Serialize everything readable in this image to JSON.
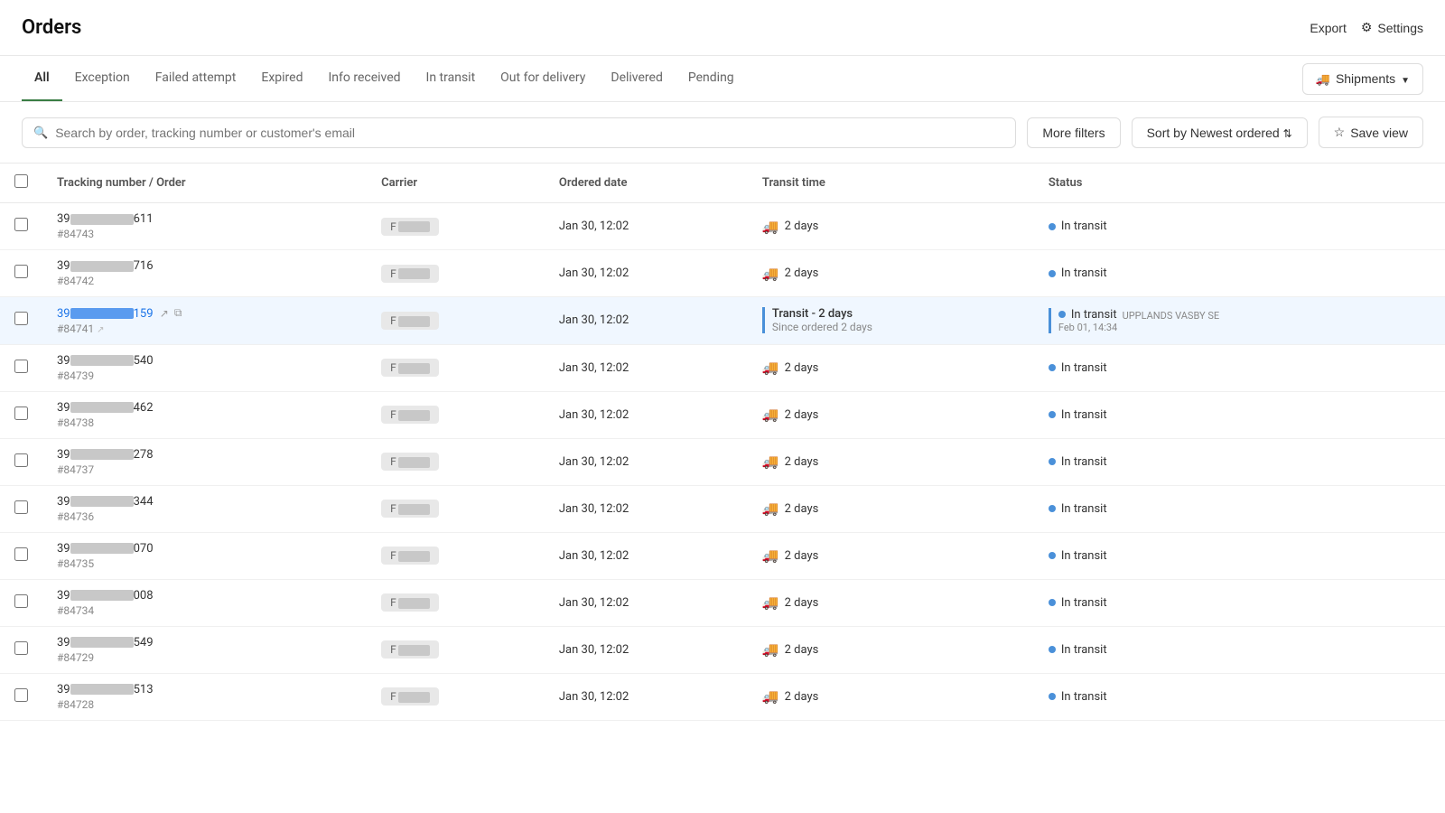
{
  "header": {
    "title": "Orders",
    "export_label": "Export",
    "settings_label": "Settings"
  },
  "tabs": {
    "items": [
      {
        "id": "all",
        "label": "All",
        "active": true
      },
      {
        "id": "exception",
        "label": "Exception",
        "active": false
      },
      {
        "id": "failed_attempt",
        "label": "Failed attempt",
        "active": false
      },
      {
        "id": "expired",
        "label": "Expired",
        "active": false
      },
      {
        "id": "info_received",
        "label": "Info received",
        "active": false
      },
      {
        "id": "in_transit",
        "label": "In transit",
        "active": false
      },
      {
        "id": "out_for_delivery",
        "label": "Out for delivery",
        "active": false
      },
      {
        "id": "delivered",
        "label": "Delivered",
        "active": false
      },
      {
        "id": "pending",
        "label": "Pending",
        "active": false
      }
    ],
    "shipments_label": "Shipments"
  },
  "toolbar": {
    "search_placeholder": "Search by order, tracking number or customer's email",
    "more_filters_label": "More filters",
    "sort_label": "Sort by",
    "sort_value": "Newest ordered",
    "save_view_label": "Save view"
  },
  "table": {
    "columns": [
      {
        "id": "tracking",
        "label": "Tracking number / Order"
      },
      {
        "id": "carrier",
        "label": "Carrier"
      },
      {
        "id": "ordered_date",
        "label": "Ordered date"
      },
      {
        "id": "transit_time",
        "label": "Transit time"
      },
      {
        "id": "status",
        "label": "Status"
      }
    ],
    "rows": [
      {
        "id": 1,
        "tracking_prefix": "39",
        "tracking_suffix": "611",
        "tracking_blurred_width": 70,
        "order": "#84743",
        "carrier": "F",
        "carrier_blurred_width": 35,
        "ordered_date": "Jan 30, 12:02",
        "transit_days": "2 days",
        "status": "In transit",
        "highlighted": false
      },
      {
        "id": 2,
        "tracking_prefix": "39",
        "tracking_suffix": "716",
        "tracking_blurred_width": 70,
        "order": "#84742",
        "carrier": "F",
        "carrier_blurred_width": 35,
        "ordered_date": "Jan 30, 12:02",
        "transit_days": "2 days",
        "status": "In transit",
        "highlighted": false
      },
      {
        "id": 3,
        "tracking_prefix": "39",
        "tracking_suffix": "159",
        "tracking_blurred_width": 70,
        "order": "#84741",
        "carrier": "F",
        "carrier_blurred_width": 35,
        "ordered_date": "Jan 30, 12:02",
        "transit_main": "Transit - 2 days",
        "transit_sub": "Since ordered 2 days",
        "status_main": "In transit",
        "status_location": "UPPLANDS VASBY SE",
        "status_time": "Feb 01, 14:34",
        "highlighted": true
      },
      {
        "id": 4,
        "tracking_prefix": "39",
        "tracking_suffix": "540",
        "tracking_blurred_width": 70,
        "order": "#84739",
        "carrier": "F",
        "carrier_blurred_width": 35,
        "ordered_date": "Jan 30, 12:02",
        "transit_days": "2 days",
        "status": "In transit",
        "highlighted": false
      },
      {
        "id": 5,
        "tracking_prefix": "39",
        "tracking_suffix": "462",
        "tracking_blurred_width": 70,
        "order": "#84738",
        "carrier": "F",
        "carrier_blurred_width": 35,
        "ordered_date": "Jan 30, 12:02",
        "transit_days": "2 days",
        "status": "In transit",
        "highlighted": false
      },
      {
        "id": 6,
        "tracking_prefix": "39",
        "tracking_suffix": "278",
        "tracking_blurred_width": 70,
        "order": "#84737",
        "carrier": "F",
        "carrier_blurred_width": 35,
        "ordered_date": "Jan 30, 12:02",
        "transit_days": "2 days",
        "status": "In transit",
        "highlighted": false
      },
      {
        "id": 7,
        "tracking_prefix": "39",
        "tracking_suffix": "344",
        "tracking_blurred_width": 70,
        "order": "#84736",
        "carrier": "F",
        "carrier_blurred_width": 35,
        "ordered_date": "Jan 30, 12:02",
        "transit_days": "2 days",
        "status": "In transit",
        "highlighted": false
      },
      {
        "id": 8,
        "tracking_prefix": "39",
        "tracking_suffix": "070",
        "tracking_blurred_width": 70,
        "order": "#84735",
        "carrier": "F",
        "carrier_blurred_width": 35,
        "ordered_date": "Jan 30, 12:02",
        "transit_days": "2 days",
        "status": "In transit",
        "highlighted": false
      },
      {
        "id": 9,
        "tracking_prefix": "39",
        "tracking_suffix": "008",
        "tracking_blurred_width": 70,
        "order": "#84734",
        "carrier": "F",
        "carrier_blurred_width": 35,
        "ordered_date": "Jan 30, 12:02",
        "transit_days": "2 days",
        "status": "In transit",
        "highlighted": false
      },
      {
        "id": 10,
        "tracking_prefix": "39",
        "tracking_suffix": "549",
        "tracking_blurred_width": 70,
        "order": "#84729",
        "carrier": "F",
        "carrier_blurred_width": 35,
        "ordered_date": "Jan 30, 12:02",
        "transit_days": "2 days",
        "status": "In transit",
        "highlighted": false
      },
      {
        "id": 11,
        "tracking_prefix": "39",
        "tracking_suffix": "513",
        "tracking_blurred_width": 70,
        "order": "#84728",
        "carrier": "F",
        "carrier_blurred_width": 35,
        "ordered_date": "Jan 30, 12:02",
        "transit_days": "2 days",
        "status": "In transit",
        "highlighted": false
      }
    ]
  },
  "colors": {
    "active_tab_underline": "#3a7d44",
    "status_dot_in_transit": "#4a90d9",
    "highlight_border": "#4a90d9"
  }
}
